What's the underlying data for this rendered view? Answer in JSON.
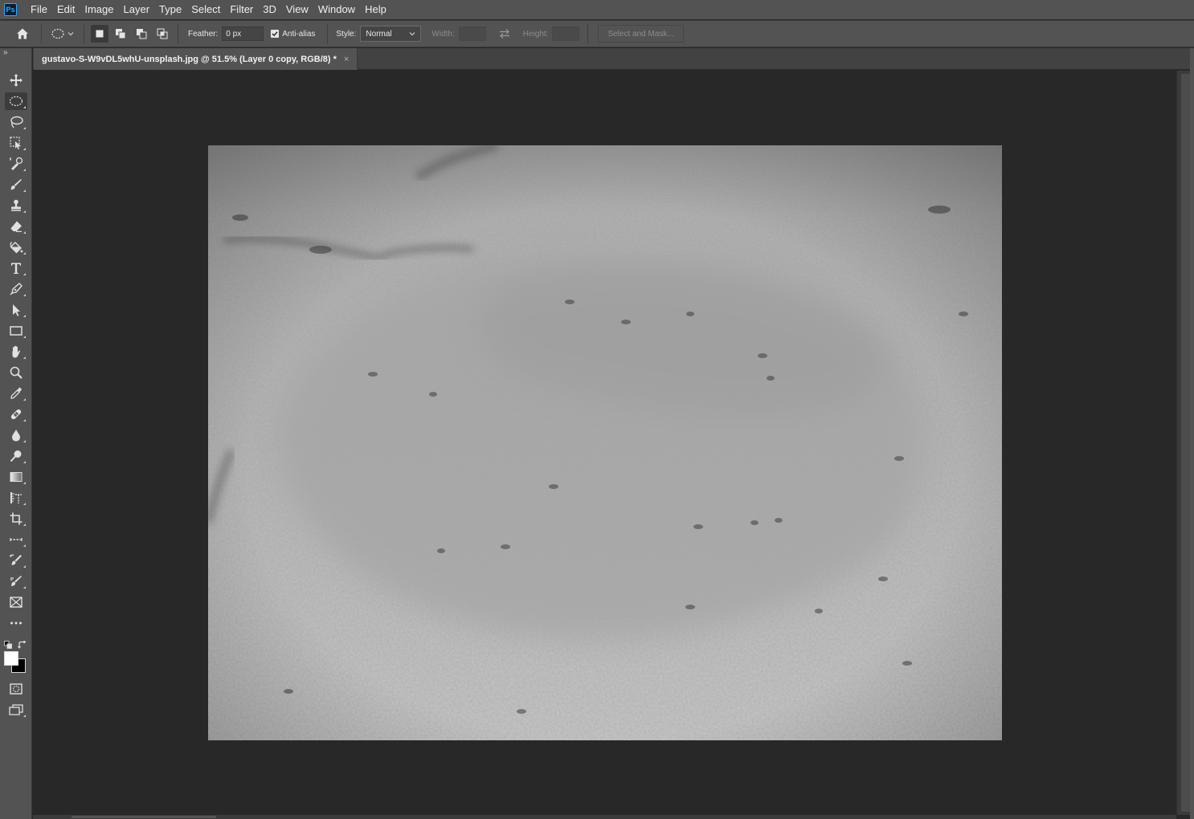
{
  "app": {
    "logo_text": "Ps"
  },
  "menu": [
    "File",
    "Edit",
    "Image",
    "Layer",
    "Type",
    "Select",
    "Filter",
    "3D",
    "View",
    "Window",
    "Help"
  ],
  "options": {
    "feather_label": "Feather:",
    "feather_value": "0 px",
    "antialias_label": "Anti-alias",
    "antialias_checked": true,
    "style_label": "Style:",
    "style_value": "Normal",
    "width_label": "Width:",
    "width_value": "",
    "height_label": "Height:",
    "height_value": "",
    "select_mask_label": "Select and Mask..."
  },
  "document": {
    "tab_title": "gustavo-S-W9vDL5whU-unsplash.jpg @ 51.5% (Layer 0 copy, RGB/8) *",
    "close_glyph": "×"
  },
  "tools": [
    {
      "name": "move-tool",
      "icon": "move-icon"
    },
    {
      "name": "elliptical-marquee-tool",
      "icon": "ellipse-marquee-icon",
      "active": true
    },
    {
      "name": "lasso-tool",
      "icon": "lasso-icon"
    },
    {
      "name": "object-selection-tool",
      "icon": "object-select-icon"
    },
    {
      "name": "eyedropper-brush-tool",
      "icon": "quick-select-icon"
    },
    {
      "name": "brush-tool",
      "icon": "brush-icon"
    },
    {
      "name": "stamp-tool",
      "icon": "stamp-icon"
    },
    {
      "name": "eraser-tool",
      "icon": "eraser-icon"
    },
    {
      "name": "paint-bucket-tool",
      "icon": "bucket-icon"
    },
    {
      "name": "type-tool",
      "icon": "type-icon"
    },
    {
      "name": "pen-tool",
      "icon": "pen-icon"
    },
    {
      "name": "path-selection-tool",
      "icon": "arrow-icon"
    },
    {
      "name": "rectangle-tool",
      "icon": "rectangle-icon"
    },
    {
      "name": "hand-tool",
      "icon": "hand-icon"
    },
    {
      "name": "zoom-tool",
      "icon": "zoom-icon"
    },
    {
      "name": "eyedropper-tool",
      "icon": "eyedropper-icon"
    },
    {
      "name": "healing-tool",
      "icon": "bandage-icon"
    },
    {
      "name": "blur-tool",
      "icon": "drop-icon"
    },
    {
      "name": "dodge-tool",
      "icon": "dodge-icon"
    },
    {
      "name": "gradient-tool",
      "icon": "gradient-icon"
    },
    {
      "name": "ruler-tool",
      "icon": "ruler-icon"
    },
    {
      "name": "crop-tool",
      "icon": "crop-icon"
    },
    {
      "name": "slice-tool",
      "icon": "dashed-line-icon"
    },
    {
      "name": "history-brush-tool",
      "icon": "history-brush-icon"
    },
    {
      "name": "mixer-brush-tool",
      "icon": "mixer-brush-icon"
    },
    {
      "name": "frame-tool",
      "icon": "frame-icon"
    },
    {
      "name": "more-tools",
      "icon": "ellipsis-icon"
    }
  ],
  "colors": {
    "foreground": "#ffffff",
    "background": "#000000",
    "ui_panel": "#535353",
    "workspace": "#282828"
  }
}
